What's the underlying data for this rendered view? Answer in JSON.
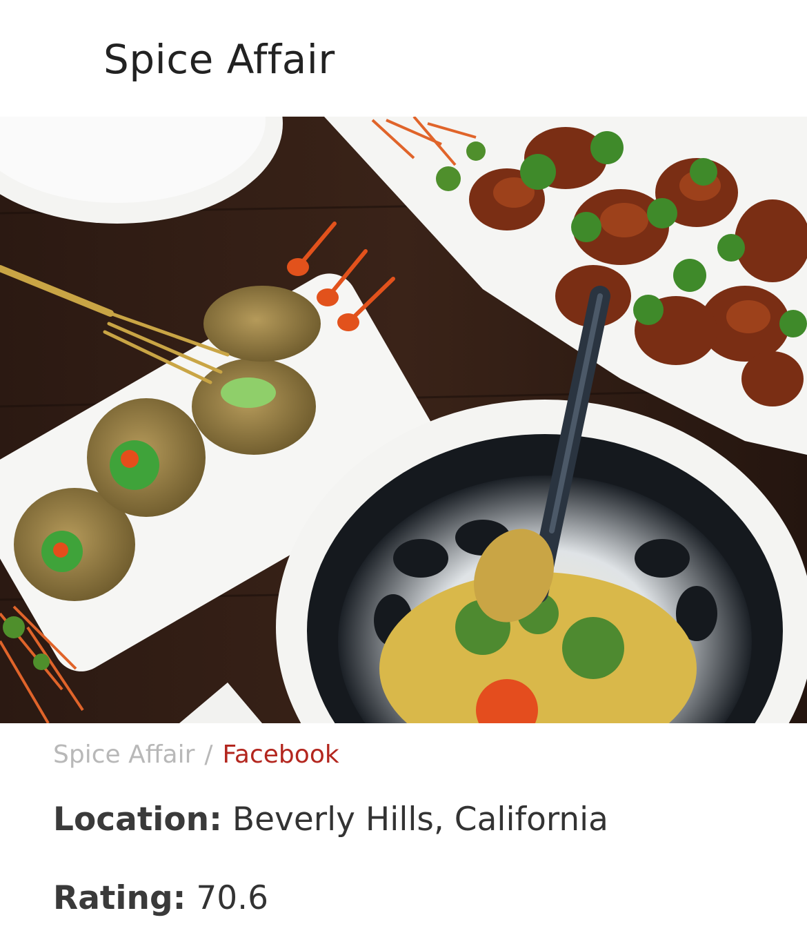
{
  "article": {
    "title": "Spice Affair",
    "image_credit": {
      "source": "Spice Affair",
      "separator": "/",
      "link_label": "Facebook"
    },
    "location": {
      "label": "Location:",
      "value": "Beverly Hills, California"
    },
    "rating": {
      "label": "Rating:",
      "value": "70.6"
    }
  },
  "colors": {
    "title": "#222222",
    "credit_muted": "#b8b8b8",
    "credit_link": "#b3261e",
    "body_text": "#3a3a3a"
  }
}
